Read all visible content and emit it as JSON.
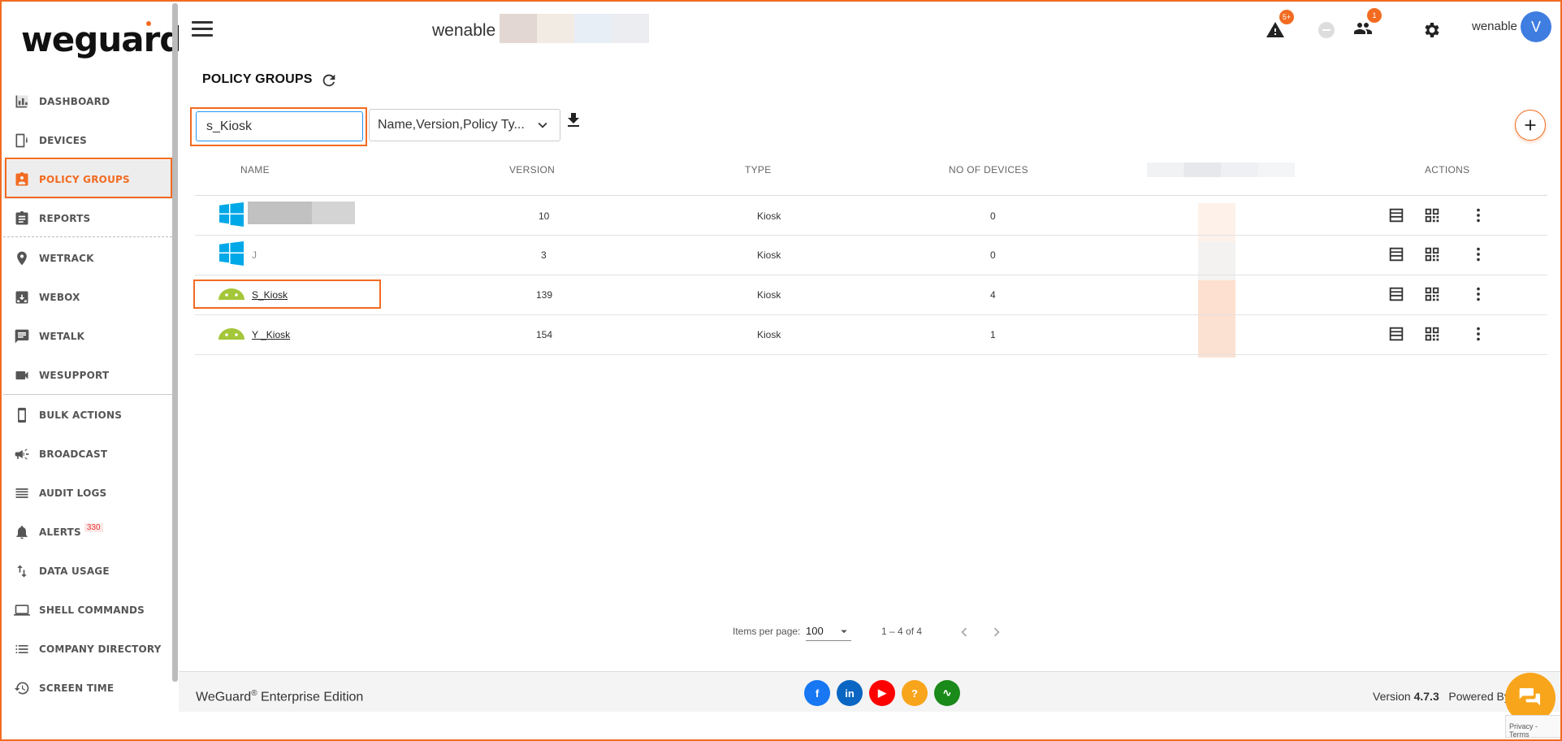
{
  "app": {
    "logo_text": "weguard",
    "tenant_name": "wenable -",
    "user_name": "wenable",
    "user_initial": "V",
    "colors": {
      "accent": "#f26b21",
      "avatar": "#3f7de0"
    }
  },
  "topbar": {
    "alerts_badge": "5+",
    "users_badge": "1",
    "icons": [
      "menu-icon",
      "warning-icon",
      "status-icon",
      "people-icon",
      "gear-icon"
    ]
  },
  "sidebar": {
    "items": [
      {
        "label": "DASHBOARD",
        "icon": "chart-icon"
      },
      {
        "label": "DEVICES",
        "icon": "devices-icon"
      },
      {
        "label": "POLICY GROUPS",
        "icon": "badge-icon",
        "active": true
      },
      {
        "label": "REPORTS",
        "icon": "clipboard-icon"
      },
      {
        "label": "WETRACK",
        "icon": "location-icon"
      },
      {
        "label": "WEBOX",
        "icon": "inbox-icon"
      },
      {
        "label": "WETALK",
        "icon": "chat-icon"
      },
      {
        "label": "WESUPPORT",
        "icon": "video-icon"
      },
      {
        "label": "BULK ACTIONS",
        "icon": "phone-icon"
      },
      {
        "label": "BROADCAST",
        "icon": "megaphone-icon"
      },
      {
        "label": "AUDIT LOGS",
        "icon": "list-icon"
      },
      {
        "label": "ALERTS",
        "icon": "bell-icon",
        "count": "330"
      },
      {
        "label": "DATA USAGE",
        "icon": "swap-icon"
      },
      {
        "label": "SHELL COMMANDS",
        "icon": "laptop-icon"
      },
      {
        "label": "COMPANY DIRECTORY",
        "icon": "directory-icon"
      },
      {
        "label": "SCREEN TIME",
        "icon": "history-icon"
      }
    ]
  },
  "page": {
    "title": "POLICY GROUPS",
    "search_value": "s_Kiosk",
    "filter_select": "Name,Version,Policy Ty..."
  },
  "table": {
    "columns": [
      "NAME",
      "VERSION",
      "TYPE",
      "NO OF DEVICES",
      "",
      "ACTIONS"
    ],
    "rows": [
      {
        "os": "windows",
        "name": "",
        "version": "10",
        "type": "Kiosk",
        "devices": "0"
      },
      {
        "os": "windows",
        "name": "J",
        "version": "3",
        "type": "Kiosk",
        "devices": "0"
      },
      {
        "os": "android",
        "name": "S_Kiosk",
        "version": "139",
        "type": "Kiosk",
        "devices": "4"
      },
      {
        "os": "android",
        "name": "Y _Kiosk",
        "version": "154",
        "type": "Kiosk",
        "devices": "1"
      }
    ]
  },
  "pagination": {
    "items_per_page_label": "Items per page:",
    "items_per_page": "100",
    "range": "1 – 4 of 4"
  },
  "footer": {
    "brand": "WeGuard",
    "brand_sup": "®",
    "brand_suffix": " Enterprise Edition",
    "version_label": "Version",
    "version": "4.7.3",
    "powered": "Powered By",
    "social": [
      {
        "name": "facebook-icon",
        "glyph": "f",
        "color": "#1877f2"
      },
      {
        "name": "linkedin-icon",
        "glyph": "in",
        "color": "#0a66c2"
      },
      {
        "name": "youtube-icon",
        "glyph": "▶",
        "color": "#ff0000"
      },
      {
        "name": "help-icon",
        "glyph": "?",
        "color": "#f8a51c"
      },
      {
        "name": "pulse-icon",
        "glyph": "∿",
        "color": "#1a8a1a"
      }
    ],
    "recaptcha": "Privacy - Terms"
  }
}
